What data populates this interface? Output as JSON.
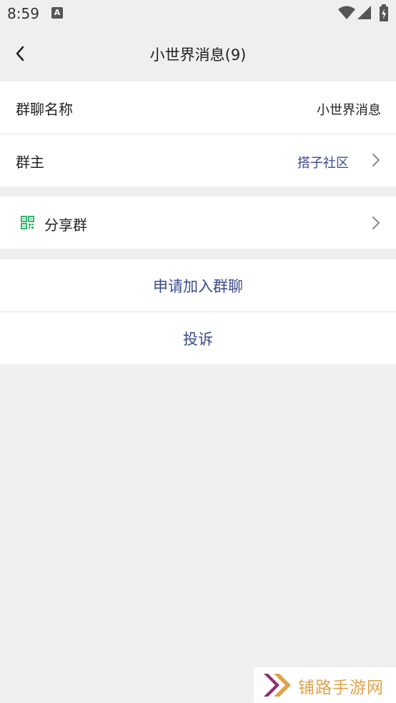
{
  "status_bar": {
    "time": "8:59",
    "notification_glyph": "A"
  },
  "header": {
    "title": "小世界消息(9)"
  },
  "group_info": {
    "name_label": "群聊名称",
    "name_value": "小世界消息",
    "owner_label": "群主",
    "owner_value": "搭子社区"
  },
  "share": {
    "label": "分享群"
  },
  "actions": {
    "join": "申请加入群聊",
    "report": "投诉"
  },
  "watermark": {
    "text": "铺路手游网"
  },
  "colors": {
    "accent": "#3a4a8c",
    "qr_green": "#2fb36b",
    "background": "#efefef",
    "watermark": "#e0a24c"
  }
}
